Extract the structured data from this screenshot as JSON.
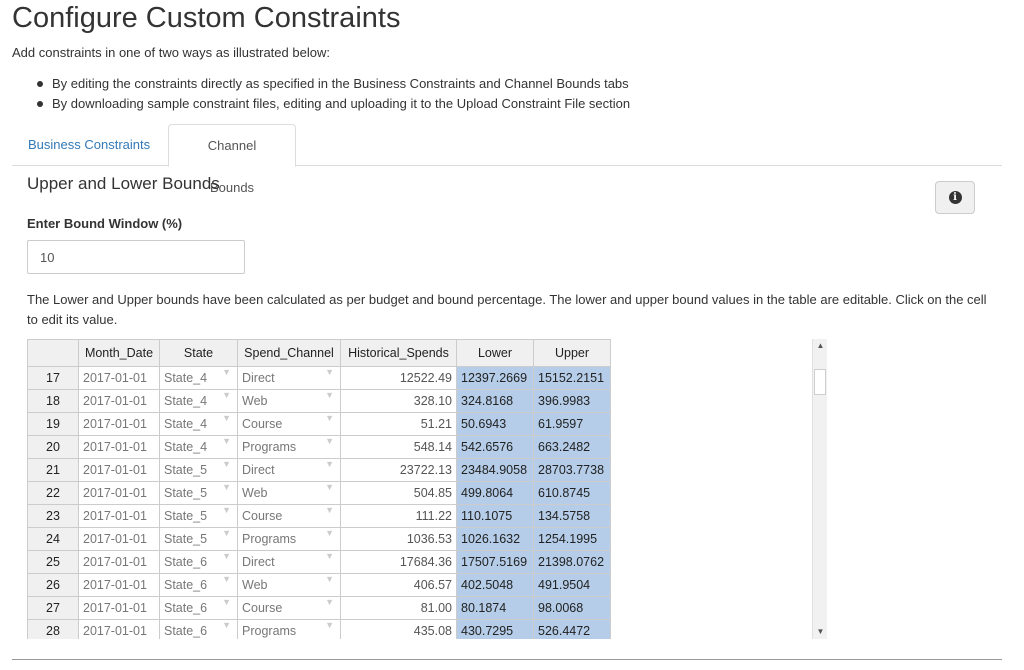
{
  "header": {
    "title": "Configure Custom Constraints",
    "intro": "Add constraints in one of two ways as illustrated below:",
    "bullets": [
      "By editing the constraints directly as specified in the Business Constraints and Channel Bounds tabs",
      "By downloading sample constraint files, editing and uploading it to the Upload Constraint File section"
    ]
  },
  "tabs": [
    {
      "label": "Business Constraints",
      "active": false
    },
    {
      "label": "Channel Bounds",
      "active": true
    }
  ],
  "bounds": {
    "section_title": "Upper and Lower Bounds",
    "info_icon": "info-circle-icon",
    "field_label": "Enter Bound Window (%)",
    "field_value": "10",
    "note": "The Lower and Upper bounds have been calculated as per budget and bound percentage. The lower and upper bound values in the table are editable. Click on the cell to edit its value."
  },
  "grid": {
    "columns": [
      "Month_Date",
      "State",
      "Spend_Channel",
      "Historical_Spends",
      "Lower",
      "Upper"
    ],
    "rows": [
      {
        "idx": "17",
        "date": "2017-01-01",
        "state": "State_4",
        "channel": "Direct",
        "spend": "12522.49",
        "lower": "12397.2669",
        "upper": "15152.2151"
      },
      {
        "idx": "18",
        "date": "2017-01-01",
        "state": "State_4",
        "channel": "Web",
        "spend": "328.10",
        "lower": "324.8168",
        "upper": "396.9983"
      },
      {
        "idx": "19",
        "date": "2017-01-01",
        "state": "State_4",
        "channel": "Course",
        "spend": "51.21",
        "lower": "50.6943",
        "upper": "61.9597"
      },
      {
        "idx": "20",
        "date": "2017-01-01",
        "state": "State_4",
        "channel": "Programs",
        "spend": "548.14",
        "lower": "542.6576",
        "upper": "663.2482"
      },
      {
        "idx": "21",
        "date": "2017-01-01",
        "state": "State_5",
        "channel": "Direct",
        "spend": "23722.13",
        "lower": "23484.9058",
        "upper": "28703.7738"
      },
      {
        "idx": "22",
        "date": "2017-01-01",
        "state": "State_5",
        "channel": "Web",
        "spend": "504.85",
        "lower": "499.8064",
        "upper": "610.8745"
      },
      {
        "idx": "23",
        "date": "2017-01-01",
        "state": "State_5",
        "channel": "Course",
        "spend": "111.22",
        "lower": "110.1075",
        "upper": "134.5758"
      },
      {
        "idx": "24",
        "date": "2017-01-01",
        "state": "State_5",
        "channel": "Programs",
        "spend": "1036.53",
        "lower": "1026.1632",
        "upper": "1254.1995"
      },
      {
        "idx": "25",
        "date": "2017-01-01",
        "state": "State_6",
        "channel": "Direct",
        "spend": "17684.36",
        "lower": "17507.5169",
        "upper": "21398.0762"
      },
      {
        "idx": "26",
        "date": "2017-01-01",
        "state": "State_6",
        "channel": "Web",
        "spend": "406.57",
        "lower": "402.5048",
        "upper": "491.9504"
      },
      {
        "idx": "27",
        "date": "2017-01-01",
        "state": "State_6",
        "channel": "Course",
        "spend": "81.00",
        "lower": "80.1874",
        "upper": "98.0068"
      },
      {
        "idx": "28",
        "date": "2017-01-01",
        "state": "State_6",
        "channel": "Programs",
        "spend": "435.08",
        "lower": "430.7295",
        "upper": "526.4472"
      }
    ]
  },
  "colors": {
    "link": "#337ab7",
    "selected_cell": "#b5cde8",
    "header_bg": "#f0f0f0"
  }
}
